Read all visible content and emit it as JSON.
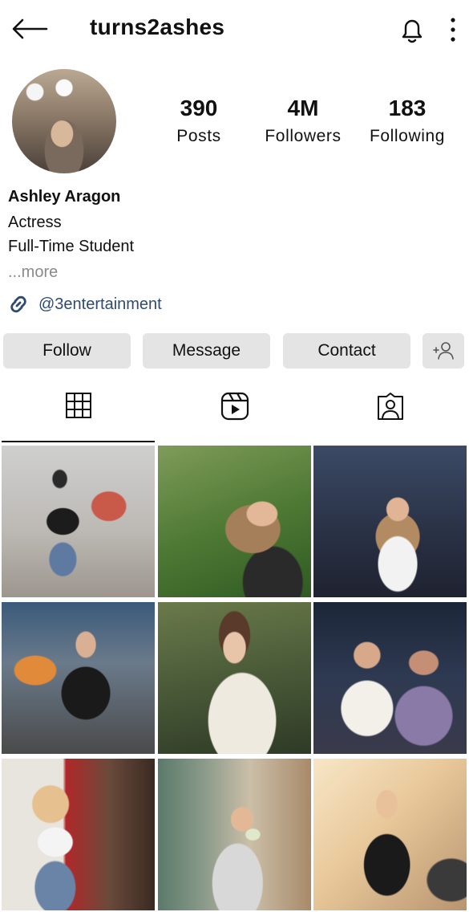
{
  "header": {
    "username": "turns2ashes",
    "back_icon": "back-arrow-icon",
    "bell_icon": "bell-icon",
    "more_icon": "vertical-dots-icon"
  },
  "profile": {
    "stats": [
      {
        "value": "390",
        "label": "Posts"
      },
      {
        "value": "4M",
        "label": "Followers"
      },
      {
        "value": "183",
        "label": "Following"
      }
    ],
    "full_name": "Ashley Aragon",
    "bio_lines": [
      "Actress",
      "Full-Time Student"
    ],
    "more_label": "...more",
    "link": "@3entertainment"
  },
  "buttons": {
    "follow": "Follow",
    "message": "Message",
    "contact": "Contact",
    "suggest_icon": "add-person-icon"
  },
  "tabs": [
    {
      "icon": "grid-icon",
      "active": true
    },
    {
      "icon": "reels-icon",
      "active": false
    },
    {
      "icon": "tagged-icon",
      "active": false
    }
  ],
  "grid": {
    "rows": 3,
    "cols": 3,
    "post_count_visible": 9
  }
}
